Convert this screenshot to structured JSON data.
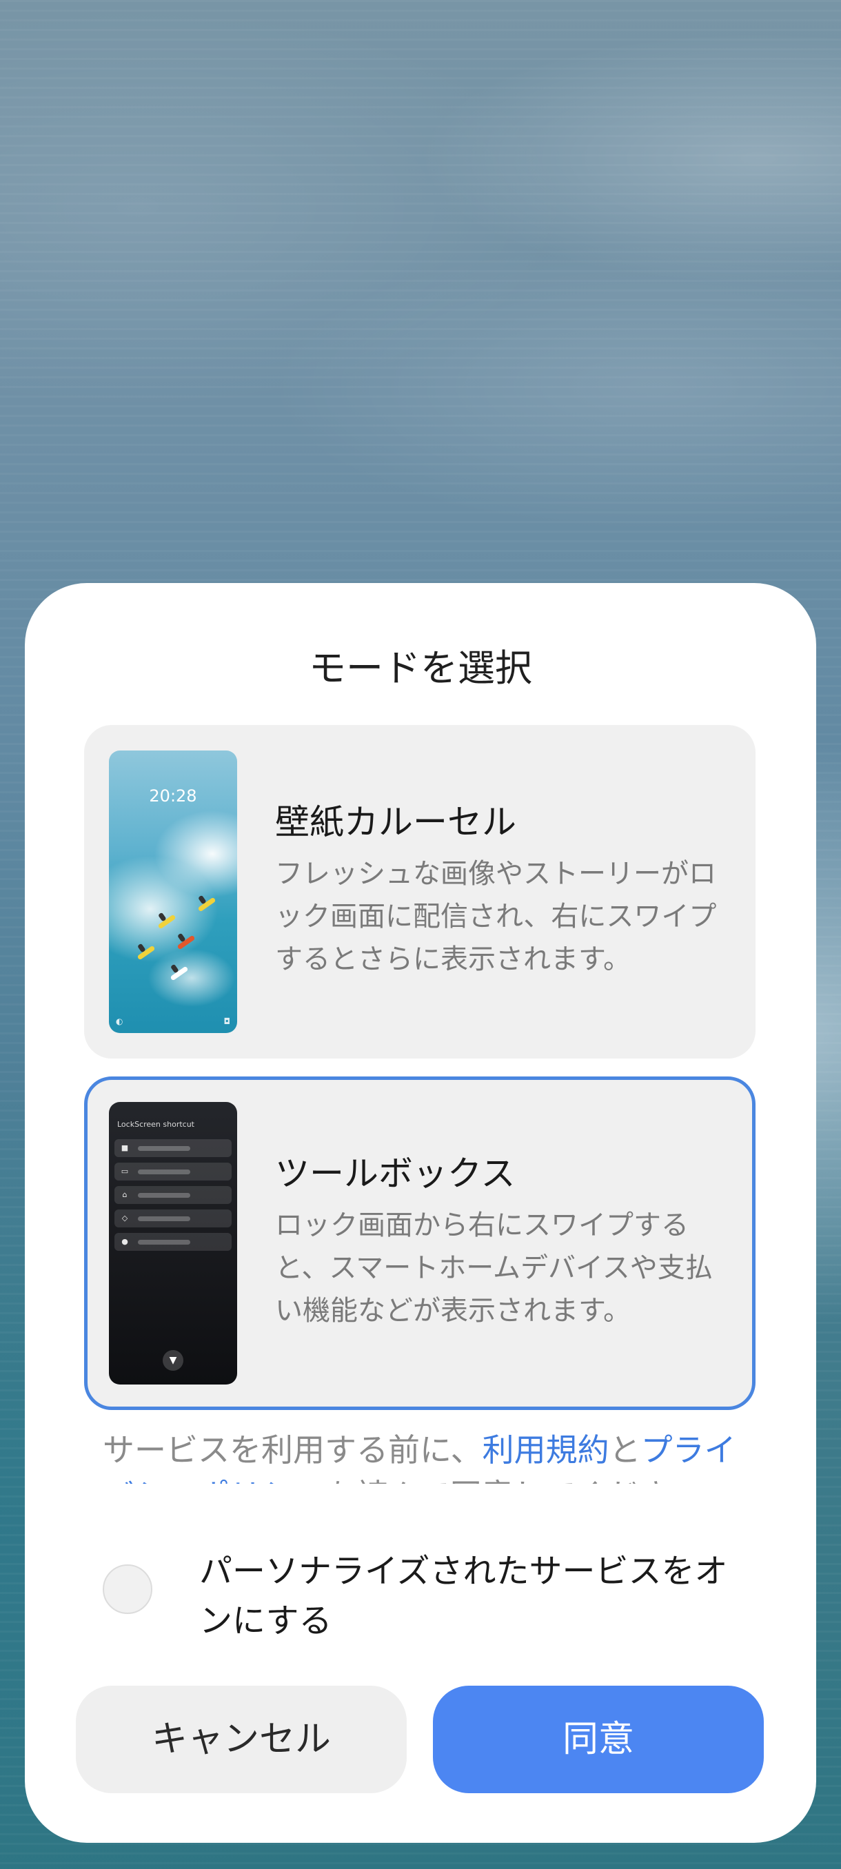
{
  "dialog": {
    "title": "モードを選択",
    "modes": [
      {
        "title": "壁紙カルーセル",
        "description": "フレッシュな画像やストーリーがロック画面に配信され、右にスワイプするとさらに表示されます。",
        "preview_time": "20:28",
        "selected": false
      },
      {
        "title": "ツールボックス",
        "description": "ロック画面から右にスワイプすると、スマートホームデバイスや支払い機能などが表示されます。",
        "preview_header": "LockScreen shortcut",
        "selected": true
      }
    ],
    "consent": {
      "prefix": "サービスを利用する前に、",
      "terms_link": "利用規約",
      "joiner": "と",
      "privacy_link": "プライバシーポリシー",
      "suffix": "を読んで同意してください。"
    },
    "personalize_label": "パーソナライズされたサービスをオンにする",
    "personalize_checked": false,
    "cancel_label": "キャンセル",
    "agree_label": "同意",
    "accent_color": "#4c86f2",
    "selected_border_color": "#4a86e0"
  }
}
